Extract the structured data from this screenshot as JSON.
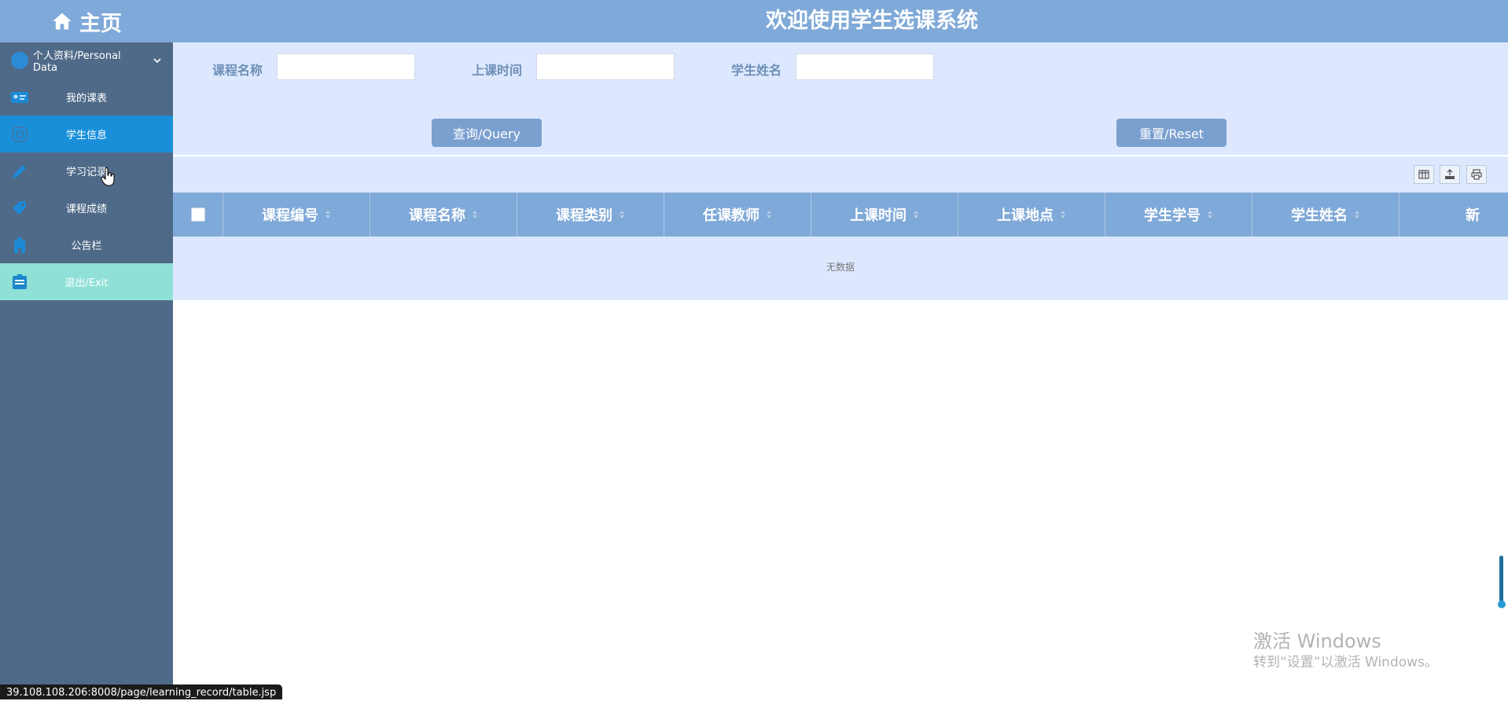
{
  "sidebar": {
    "brand": "主页",
    "profile": "个人资料/Personal Data",
    "items": [
      {
        "label": "我的课表",
        "icon": "id-card-icon"
      },
      {
        "label": "学生信息",
        "icon": "instagram-icon"
      },
      {
        "label": "学习记录",
        "icon": "pencil-icon"
      },
      {
        "label": "课程成绩",
        "icon": "tag-icon"
      },
      {
        "label": "公告栏",
        "icon": "building-icon"
      },
      {
        "label": "退出/Exit",
        "icon": "list-icon"
      }
    ]
  },
  "header": {
    "title": "欢迎使用学生选课系统"
  },
  "search": {
    "fields": [
      {
        "label": "课程名称",
        "value": ""
      },
      {
        "label": "上课时间",
        "value": ""
      },
      {
        "label": "学生姓名",
        "value": ""
      }
    ],
    "query_label": "查询/Query",
    "reset_label": "重置/Reset"
  },
  "table": {
    "columns": [
      "课程编号",
      "课程名称",
      "课程类别",
      "任课教师",
      "上课时间",
      "上课地点",
      "学生学号",
      "学生姓名",
      "新"
    ],
    "empty_text": "无数据"
  },
  "toolbar_icons": [
    "columns-icon",
    "export-icon",
    "print-icon"
  ],
  "watermark": {
    "line1": "激活 Windows",
    "line2": "转到“设置”以激活 Windows。"
  },
  "status_url": "39.108.108.206:8008/page/learning_record/table.jsp",
  "colors": {
    "primary": "#7fa9d8",
    "sidebar": "#4f6a88",
    "active": "#1a8fd9",
    "exit": "#8fe0d6",
    "panel": "#dde8ff"
  }
}
